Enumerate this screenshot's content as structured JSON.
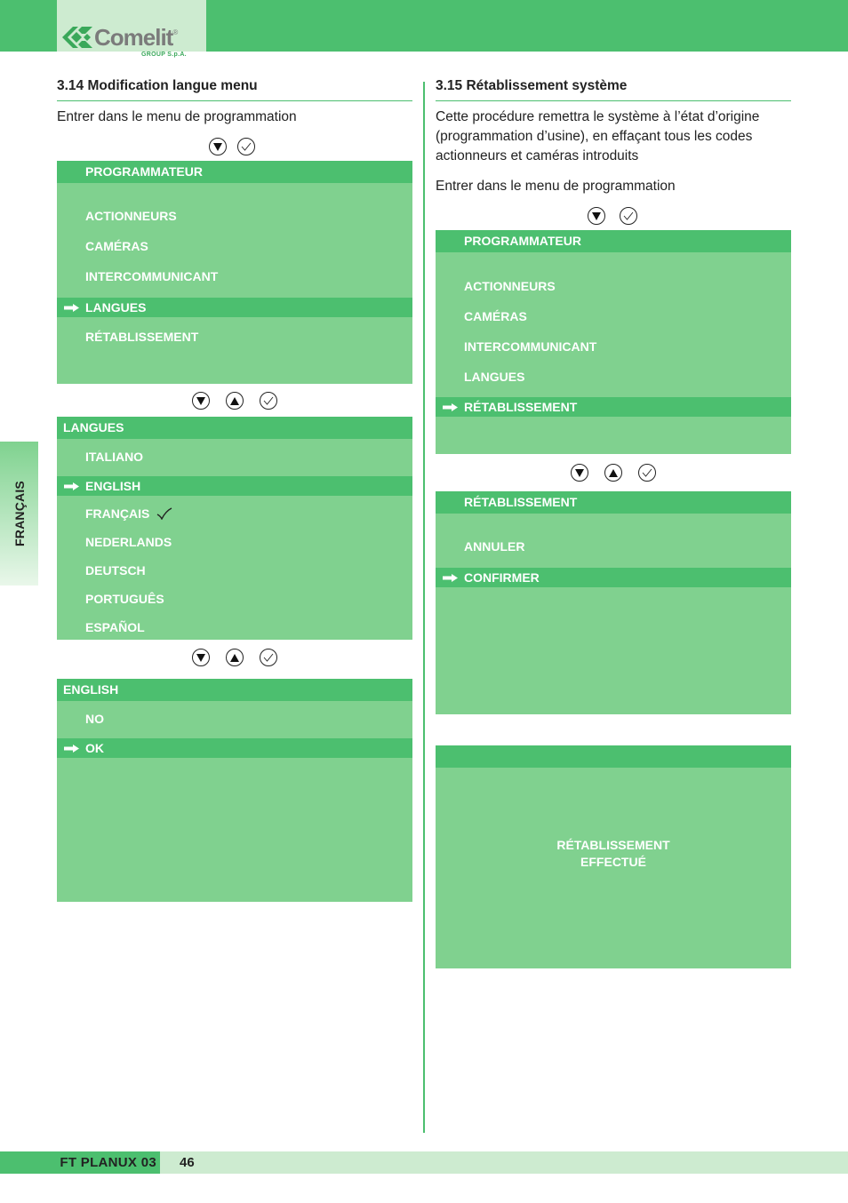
{
  "brand": {
    "name": "Comelit",
    "registered": "®",
    "subtitle": "GROUP S.p.A."
  },
  "side_tab": {
    "label": "FRANÇAIS"
  },
  "colors": {
    "primary_green": "#4cbf6f",
    "screen_green": "#80d18f",
    "light_green": "#cdebd0",
    "text": "#222222"
  },
  "left": {
    "title": "3.14 Modification langue menu",
    "intro": "Entrer dans le menu de programmation",
    "nav1": [
      "down-button",
      "confirm-button"
    ],
    "screen1": {
      "header": "PROGRAMMATEUR",
      "items": [
        {
          "label": "ACTIONNEURS",
          "selected": false
        },
        {
          "label": "CAMÉRAS",
          "selected": false
        },
        {
          "label": "INTERCOMMUNICANT",
          "selected": false
        },
        {
          "label": "LANGUES",
          "selected": true
        },
        {
          "label": "RÉTABLISSEMENT",
          "selected": false
        }
      ]
    },
    "nav2": [
      "down-button",
      "up-button",
      "confirm-button"
    ],
    "screen2": {
      "header": "LANGUES",
      "items": [
        {
          "label": "ITALIANO",
          "selected": false
        },
        {
          "label": "ENGLISH",
          "selected": true
        },
        {
          "label": "FRANÇAIS",
          "selected": false,
          "checked": true
        },
        {
          "label": "NEDERLANDS",
          "selected": false
        },
        {
          "label": "DEUTSCH",
          "selected": false
        },
        {
          "label": "PORTUGUÊS",
          "selected": false
        },
        {
          "label": "ESPAÑOL",
          "selected": false
        }
      ]
    },
    "nav3": [
      "down-button",
      "up-button",
      "confirm-button"
    ],
    "screen3": {
      "header": "ENGLISH",
      "items": [
        {
          "label": "NO",
          "selected": false
        },
        {
          "label": "OK",
          "selected": true
        }
      ]
    }
  },
  "right": {
    "title": "3.15 Rétablissement système",
    "description_lines": [
      "Cette procédure remettra le système à l’état d’origine",
      "(programmation d’usine), en effaçant tous les codes",
      "actionneurs et caméras introduits"
    ],
    "intro": "Entrer dans le menu de programmation",
    "nav1": [
      "down-button",
      "confirm-button"
    ],
    "screen1": {
      "header": "PROGRAMMATEUR",
      "items": [
        {
          "label": "ACTIONNEURS",
          "selected": false
        },
        {
          "label": "CAMÉRAS",
          "selected": false
        },
        {
          "label": "INTERCOMMUNICANT",
          "selected": false
        },
        {
          "label": "LANGUES",
          "selected": false
        },
        {
          "label": "RÉTABLISSEMENT",
          "selected": true
        }
      ]
    },
    "nav2": [
      "down-button",
      "up-button",
      "confirm-button"
    ],
    "screen2": {
      "header": "RÉTABLISSEMENT",
      "items": [
        {
          "label": "ANNULER",
          "selected": false
        },
        {
          "label": "CONFIRMER",
          "selected": true
        }
      ]
    },
    "screen3": {
      "header": "",
      "message_lines": [
        "RÉTABLISSEMENT",
        "EFFECTUÉ"
      ]
    }
  },
  "footer": {
    "title": "FT PLANUX 03",
    "page": "46"
  }
}
